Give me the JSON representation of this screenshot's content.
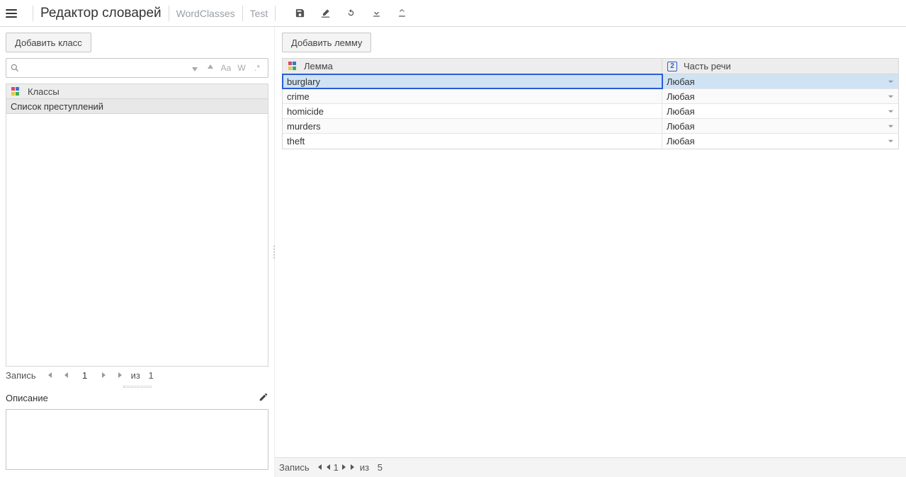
{
  "header": {
    "title": "Редактор словарей",
    "crumb1": "WordClasses",
    "crumb2": "Test"
  },
  "toolbar": {
    "save": "save",
    "erase": "erase",
    "refresh": "refresh",
    "download": "download",
    "upload": "upload"
  },
  "left": {
    "add_class_btn": "Добавить класс",
    "search_placeholder": "",
    "sort_desc_tip": "↓",
    "sort_asc_tip": "↑",
    "case_toggle": "Aa",
    "whole_word": "W",
    "regex": ".*",
    "classes_header": "Классы",
    "classes": [
      {
        "name": "Список преступлений"
      }
    ],
    "pager": {
      "label": "Запись",
      "current": "1",
      "of_prefix": "из",
      "total": "1"
    },
    "description_label": "Описание",
    "description_value": ""
  },
  "right": {
    "add_lemma_btn": "Добавить лемму",
    "col_lemma": "Лемма",
    "col_pos": "Часть речи",
    "col_pos_badge": "2",
    "rows": [
      {
        "lemma": "burglary",
        "pos": "Любая",
        "selected": true
      },
      {
        "lemma": "crime",
        "pos": "Любая",
        "selected": false
      },
      {
        "lemma": "homicide",
        "pos": "Любая",
        "selected": false
      },
      {
        "lemma": "murders",
        "pos": "Любая",
        "selected": false
      },
      {
        "lemma": "theft",
        "pos": "Любая",
        "selected": false
      }
    ],
    "pager": {
      "label": "Запись",
      "current": "1",
      "of_prefix": "из",
      "total": "5"
    }
  }
}
